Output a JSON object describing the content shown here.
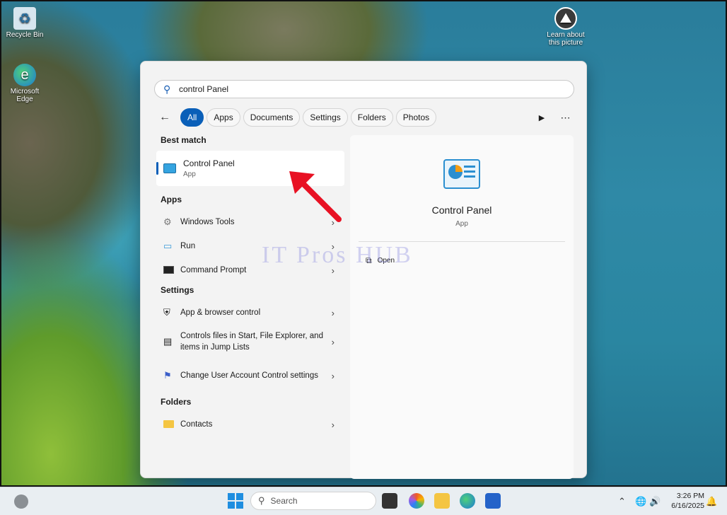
{
  "desktop": {
    "icons": [
      {
        "label": "Recycle Bin"
      },
      {
        "label": "Microsoft Edge"
      },
      {
        "label": "Learn about this picture"
      }
    ]
  },
  "search": {
    "query": "control Panel"
  },
  "filters": [
    "All",
    "Apps",
    "Documents",
    "Settings",
    "Folders",
    "Photos"
  ],
  "best_match": {
    "heading": "Best match",
    "title": "Control Panel",
    "subtitle": "App"
  },
  "apps": {
    "heading": "Apps",
    "items": [
      "Windows Tools",
      "Run",
      "Command Prompt"
    ]
  },
  "settings": {
    "heading": "Settings",
    "items": [
      "App & browser control",
      "Controls files in Start, File Explorer, and items in Jump Lists",
      "Change User Account Control settings"
    ]
  },
  "folders": {
    "heading": "Folders",
    "items": [
      "Contacts"
    ]
  },
  "detail": {
    "title": "Control Panel",
    "subtitle": "App",
    "open_label": "Open"
  },
  "watermark": "IT Pros HUB",
  "taskbar": {
    "search_placeholder": "Search",
    "time": "3:26 PM",
    "date": "6/16/2025"
  },
  "colors": {
    "accent": "#0a5fb8",
    "arrow": "#e81123"
  }
}
